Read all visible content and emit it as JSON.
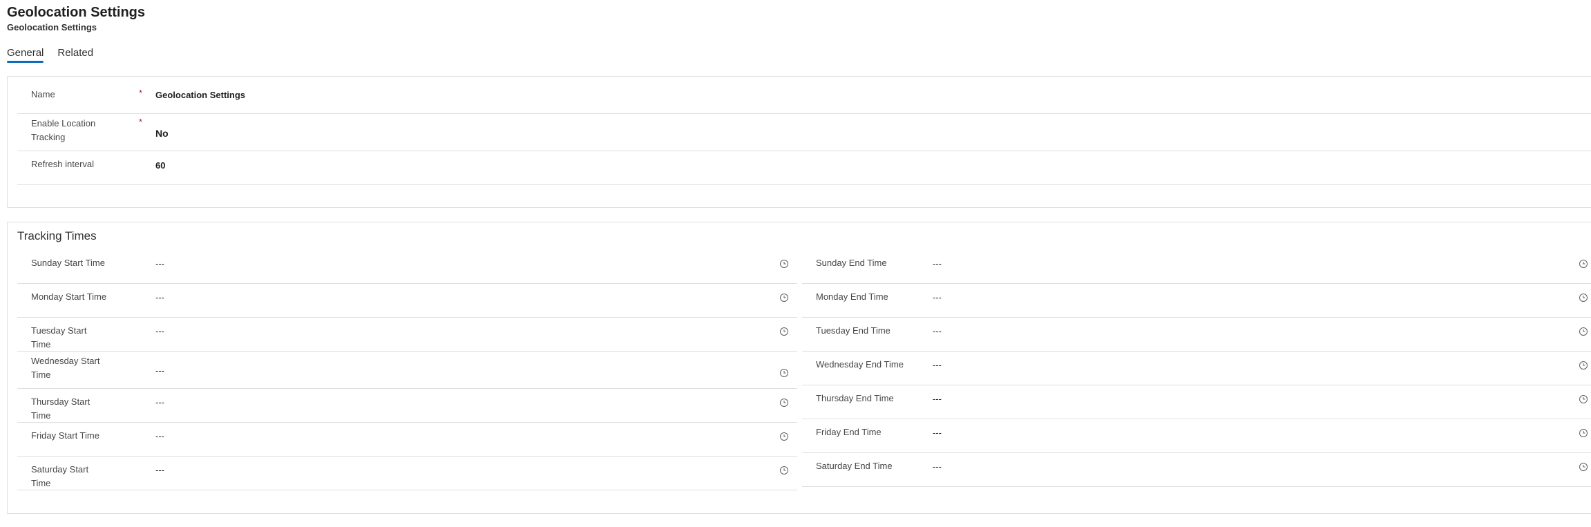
{
  "header": {
    "title": "Geolocation Settings",
    "subtitle": "Geolocation Settings"
  },
  "tabs": [
    {
      "label": "General",
      "active": true
    },
    {
      "label": "Related",
      "active": false
    }
  ],
  "general": {
    "required_marker": "*",
    "fields": [
      {
        "label": "Name",
        "value": "Geolocation Settings",
        "required": true
      },
      {
        "label": "Enable Location Tracking",
        "value": "No",
        "required": true
      },
      {
        "label": "Refresh interval",
        "value": "60",
        "required": false
      }
    ]
  },
  "tracking": {
    "title": "Tracking Times",
    "start_times": [
      {
        "label": "Sunday Start Time",
        "value": "---"
      },
      {
        "label": "Monday Start Time",
        "value": "---"
      },
      {
        "label": "Tuesday Start Time",
        "value": "---"
      },
      {
        "label": "Wednesday Start Time",
        "value": "---"
      },
      {
        "label": "Thursday Start Time",
        "value": "---"
      },
      {
        "label": "Friday Start Time",
        "value": "---"
      },
      {
        "label": "Saturday Start Time",
        "value": "---"
      }
    ],
    "end_times": [
      {
        "label": "Sunday End Time",
        "value": "---"
      },
      {
        "label": "Monday End Time",
        "value": "---"
      },
      {
        "label": "Tuesday End Time",
        "value": "---"
      },
      {
        "label": "Wednesday End Time",
        "value": "---"
      },
      {
        "label": "Thursday End Time",
        "value": "---"
      },
      {
        "label": "Friday End Time",
        "value": "---"
      },
      {
        "label": "Saturday End Time",
        "value": "---"
      }
    ],
    "icon": "clock-icon"
  },
  "colors": {
    "accent": "#0f6cbd",
    "required": "#a4262c",
    "border": "#e1dfdd"
  }
}
